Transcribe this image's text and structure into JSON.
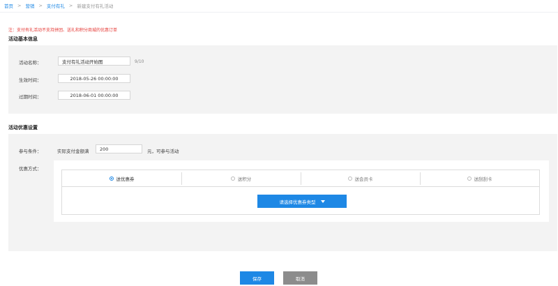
{
  "breadcrumb": {
    "items": [
      "首页",
      "营销",
      "支付有礼"
    ],
    "current": "新建支付有礼活动",
    "separator": ">"
  },
  "notice": "注：支付有礼活动不支持拼团、送礼和积分商城的优惠订单",
  "basic_info": {
    "title": "活动基本信息",
    "name_label": "活动名称：",
    "name_value": "支付有礼活动开始图",
    "name_counter": "9/10",
    "start_label": "生效时间：",
    "start_value": "2018-05-26 00:00:00",
    "end_label": "过期时间：",
    "end_value": "2018-06-01 00:00:00"
  },
  "offer_settings": {
    "title": "活动优惠设置",
    "condition_label": "参与条件：",
    "condition_prefix": "实际支付金额满",
    "condition_value": "200",
    "condition_suffix": "元，可参与活动",
    "method_label": "优惠方式：",
    "tabs": [
      {
        "label": "送优惠券",
        "checked": true
      },
      {
        "label": "送积分",
        "checked": false
      },
      {
        "label": "送会员卡",
        "checked": false
      },
      {
        "label": "送刮刮卡",
        "checked": false
      }
    ],
    "select_coupon_label": "请选择优惠券类型"
  },
  "actions": {
    "save_label": "保存",
    "cancel_label": "取消"
  },
  "colors": {
    "primary": "#1e88e5",
    "notice": "#e53935",
    "panel_bg": "#f3f3f3",
    "cancel": "#8c8c8c"
  }
}
